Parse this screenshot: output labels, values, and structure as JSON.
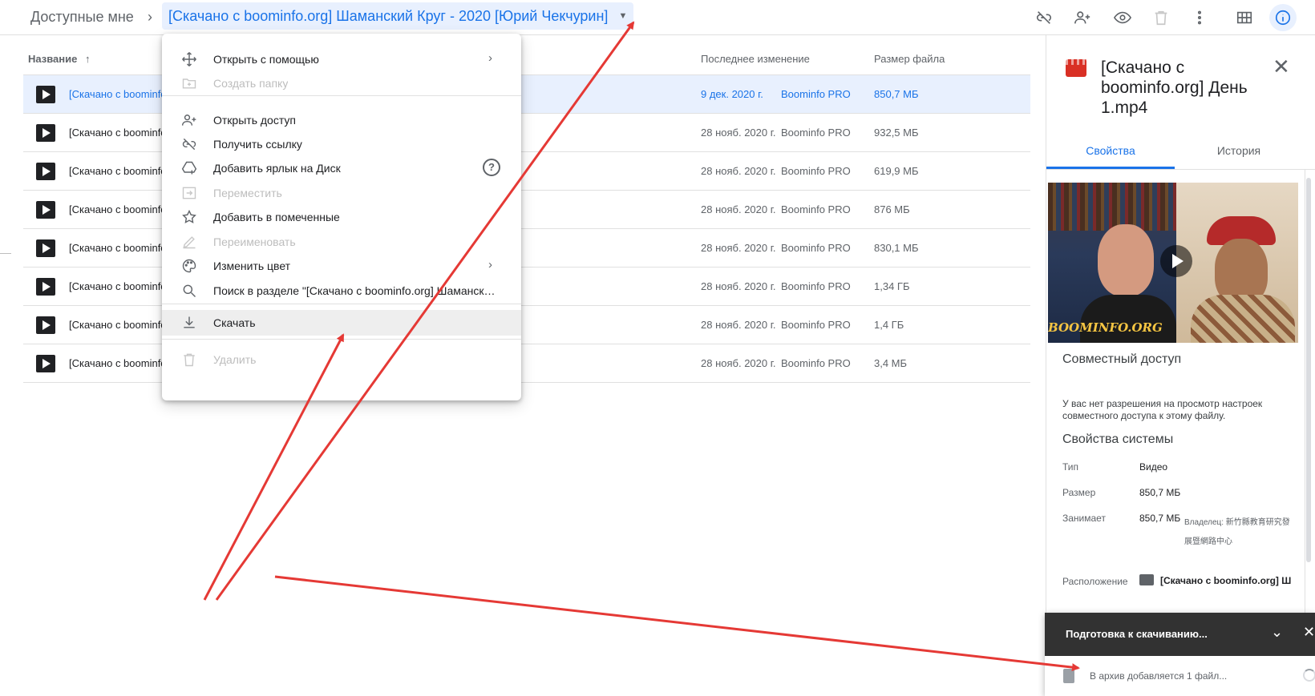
{
  "header": {
    "breadcrumb_root": "Доступные мне",
    "breadcrumb_sep": "›",
    "breadcrumb_current": "[Скачано с boominfo.org] Шаманский Круг - 2020 [Юрий Чекчурин]",
    "breadcrumb_caret": "▼",
    "toolbar_icons": [
      "link-off-icon",
      "add-person-icon",
      "eye-icon",
      "trash-icon",
      "more-vert-icon",
      "grid-view-icon",
      "info-icon"
    ]
  },
  "list": {
    "headers": {
      "name": "Название",
      "sort_arrow": "↑",
      "modified": "Последнее изменение",
      "size": "Размер файла"
    },
    "rows": [
      {
        "name": "[Скачано с boominfo.org] День 1.mp4",
        "modified": "9 дек. 2020 г.",
        "owner": "Boominfo PRO",
        "size": "850,7 МБ",
        "selected": true
      },
      {
        "name": "[Скачано с boominfo.org]",
        "modified": "28 нояб. 2020 г.",
        "owner": "Boominfo PRO",
        "size": "932,5 МБ"
      },
      {
        "name": "[Скачано с boominfo.org]",
        "modified": "28 нояб. 2020 г.",
        "owner": "Boominfo PRO",
        "size": "619,9 МБ"
      },
      {
        "name": "[Скачано с boominfo.org]",
        "modified": "28 нояб. 2020 г.",
        "owner": "Boominfo PRO",
        "size": "876 МБ"
      },
      {
        "name": "[Скачано с boominfo.org]",
        "modified": "28 нояб. 2020 г.",
        "owner": "Boominfo PRO",
        "size": "830,1 МБ"
      },
      {
        "name": "[Скачано с boominfo.org]",
        "modified": "28 нояб. 2020 г.",
        "owner": "Boominfo PRO",
        "size": "1,34 ГБ"
      },
      {
        "name": "[Скачано с boominfo.org]",
        "modified": "28 нояб. 2020 г.",
        "owner": "Boominfo PRO",
        "size": "1,4 ГБ"
      },
      {
        "name": "[Скачано с boominfo.org]",
        "modified": "28 нояб. 2020 г.",
        "owner": "Boominfo PRO",
        "size": "3,4 МБ"
      }
    ]
  },
  "menu": {
    "items": [
      {
        "label": "Открыть с помощью",
        "icon": "move-icon",
        "submenu_arrow": "›"
      },
      {
        "label": "Создать папку",
        "icon": "new-folder-icon",
        "disabled": true
      },
      {
        "label": "Открыть доступ",
        "icon": "add-person-icon"
      },
      {
        "label": "Получить ссылку",
        "icon": "link-off-icon"
      },
      {
        "label": "Добавить ярлык на Диск",
        "icon": "drive-shortcut-icon",
        "help": "?"
      },
      {
        "label": "Переместить",
        "icon": "move-to-icon",
        "disabled": true
      },
      {
        "label": "Добавить в помеченные",
        "icon": "star-icon"
      },
      {
        "label": "Переименовать",
        "icon": "pencil-icon",
        "disabled": true
      },
      {
        "label": "Изменить цвет",
        "icon": "palette-icon",
        "submenu_arrow": "›"
      },
      {
        "label": "Поиск в разделе \"[Скачано с boominfo.org] Шаманск…",
        "icon": "search-icon"
      },
      {
        "label": "Скачать",
        "icon": "download-icon",
        "highlighted": true
      },
      {
        "label": "Удалить",
        "icon": "trash-icon",
        "disabled": true
      }
    ]
  },
  "details": {
    "title": "[Скачано с boominfo.org] День 1.mp4",
    "close": "✕",
    "tabs": [
      "Свойства",
      "История"
    ],
    "preview_watermark": "BOOMINFO.ORG",
    "sharing_title": "Совместный доступ",
    "sharing_text": "У вас нет разрешения на просмотр настроек совместного доступа к этому файлу.",
    "system_title": "Свойства системы",
    "props": {
      "type_label": "Тип",
      "type_value": "Видео",
      "size_label": "Размер",
      "size_value": "850,7 МБ",
      "occupies_label": "Занимает",
      "occupies_value": "850,7 МБ",
      "owner_note": "Владелец: 新竹縣教育研究發展暨網路中心",
      "location_label": "Расположение",
      "location_value": "[Скачано с boominfo.org] Ш"
    }
  },
  "toast": {
    "title": "Подготовка к скачиванию...",
    "chevron": "⌄",
    "close": "✕",
    "message": "В архив добавляется 1 файл..."
  },
  "colors": {
    "accent": "#1a73e8",
    "selected_row": "#e8f0fe",
    "arrow": "#e53935",
    "file_icon": "#d93025",
    "toast_bg": "#323232"
  }
}
